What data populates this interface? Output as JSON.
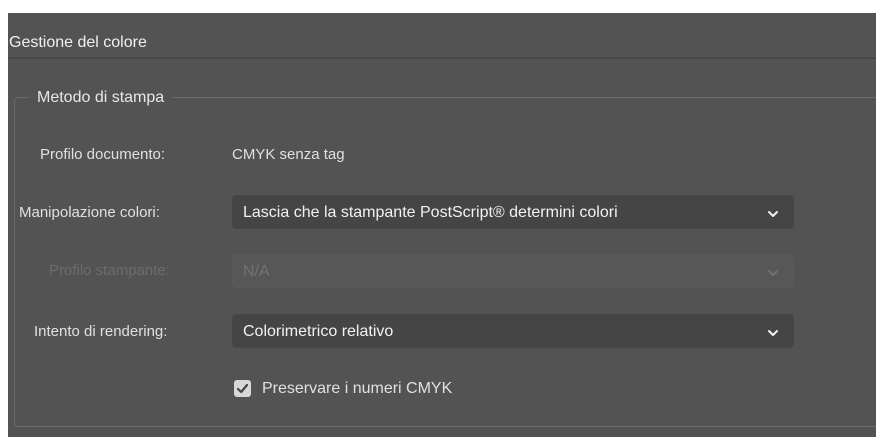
{
  "panel": {
    "title": "Gestione del colore"
  },
  "group": {
    "legend": "Metodo di stampa"
  },
  "document_profile": {
    "label": "Profilo documento:",
    "value": "CMYK senza tag"
  },
  "color_handling": {
    "label": "Manipolazione colori:",
    "value": "Lascia che la stampante PostScript® determini colori",
    "icon": "chevron-down-icon"
  },
  "printer_profile": {
    "label": "Profilo stampante:",
    "value": "N/A",
    "disabled": true,
    "icon": "chevron-down-icon"
  },
  "rendering_intent": {
    "label": "Intento di rendering:",
    "value": "Colorimetrico relativo",
    "icon": "chevron-down-icon"
  },
  "preserve_cmyk": {
    "label": "Preservare i numeri CMYK",
    "checked": true,
    "icon": "checkmark-icon"
  },
  "colors": {
    "panel_bg": "#535353",
    "field_bg": "#454545",
    "text": "#e0e0e0",
    "disabled_text": "#6c6c6c"
  }
}
